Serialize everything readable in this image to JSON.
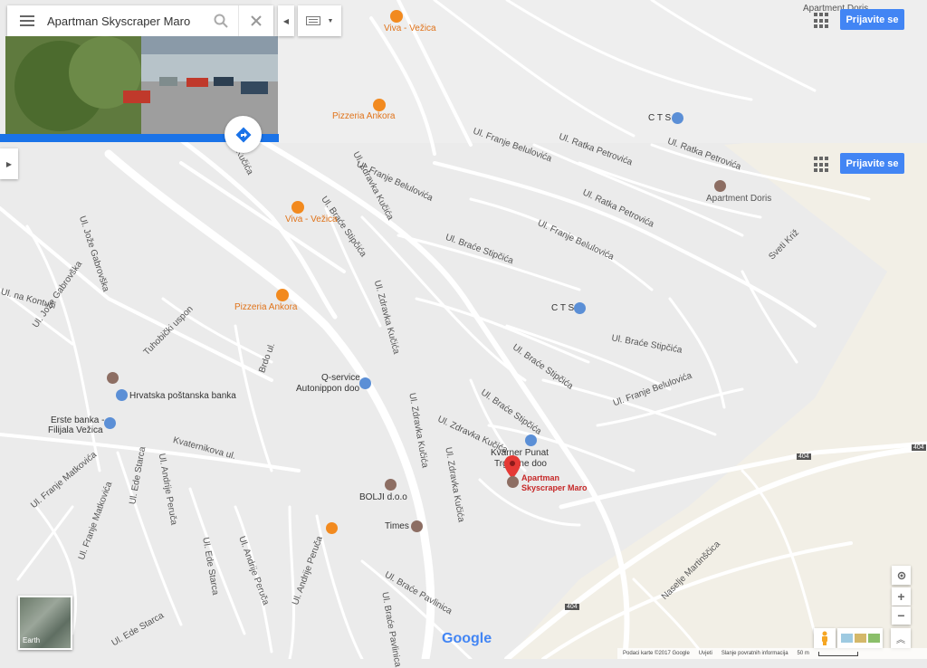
{
  "search": {
    "value": "Apartman Skyscraper Maro"
  },
  "header": {
    "signin_label": "Prijavite se"
  },
  "markers": {
    "viva_top": "Viva - Vežica",
    "pizzeria_top": "Pizzeria Ankora",
    "cts_top": "C T S",
    "apartment_doris_top": "Apartment Doris",
    "viva": "Viva - Vežica",
    "pizzeria": "Pizzeria Ankora",
    "cts": "C T S",
    "apartment_doris": "Apartment Doris",
    "q_service": "Q-service",
    "autonippon": "Autonippon doo",
    "hrvatska_posta": "Hrvatska poštanska banka",
    "erste_1": "Erste banka -",
    "erste_2": "Filijala Vežica",
    "kvarner_1": "Kvarner Punat",
    "kvarner_2": "Trgovine doo",
    "bolji": "BOLJI d.o.o",
    "times": "Times",
    "selected_1": "Apartman",
    "selected_2": "Skyscraper Maro"
  },
  "streets": {
    "zdravka_kucica": "Ul. Zdravka Kučića",
    "brace_stipcica": "Ul. Braće Stipčića",
    "franje_belulovica": "Ul. Franje Belulovića",
    "ratka_petrovica": "Ul. Ratka Petrovića",
    "sveti_kriz": "Sveti Križ",
    "joze_gabrovska": "Ul. Jože Gabrovška",
    "kontusa": "Ul. na Kontuši",
    "tuhobicki_uspon": "Tuhobički uspon",
    "brdo": "Brdo ul.",
    "kvaternikova": "Kvaternikova ul.",
    "franje_matkovica": "Ul. Franje Matkovića",
    "ede_starca": "Ul. Ede Starca",
    "andrije_peruca": "Ul. Andrije Peruča",
    "brace_pavlinica": "Ul. Braće Pavlinica",
    "naselje_martinscica": "Naselje Martinščica",
    "road_404_a": "404",
    "road_404_b": "404",
    "road_404_c": "404"
  },
  "map_type": {
    "earth_label": "Earth"
  },
  "attribution": {
    "map_data": "Podaci karte ©2017 Google",
    "terms": "Uvjeti",
    "feedback": "Slanje povratnih informacija",
    "scale": "50 m"
  },
  "logo": {
    "google": "Google"
  },
  "colors": {
    "land": "#ebebeb",
    "road": "#ffffff",
    "pin": "#e53935",
    "food_poi": "#f28a1f",
    "shop_poi": "#5b8fd6",
    "generic_poi": "#8d6e63",
    "accent": "#4285f4",
    "selected_label": "#c62828"
  },
  "icons": {
    "menu": "hamburger-icon",
    "search": "search-icon",
    "clear": "close-icon",
    "directions": "directions-icon",
    "collapse": "caret-left-icon",
    "expand": "caret-right-icon",
    "keyboard": "keyboard-icon",
    "dropdown": "caret-down-icon",
    "apps": "apps-grid-icon",
    "my_location": "my-location-icon",
    "zoom_in": "plus-icon",
    "zoom_out": "minus-icon",
    "pegman": "pegman-icon",
    "layers": "layers-icon",
    "collapse_up": "chevron-up-icon"
  }
}
